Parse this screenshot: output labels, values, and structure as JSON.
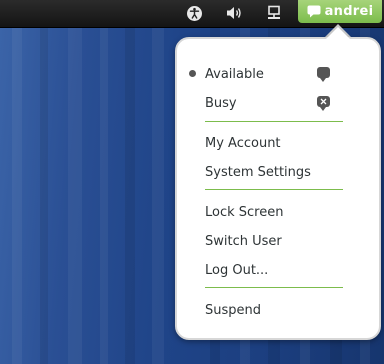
{
  "panel": {
    "icons": [
      "accessibility-icon",
      "volume-icon",
      "network-icon"
    ],
    "user_name": "andrei",
    "accent": "#7cbc4c"
  },
  "menu": {
    "status": {
      "available": "Available",
      "busy": "Busy"
    },
    "account": {
      "my_account": "My Account",
      "system_settings": "System Settings"
    },
    "session": {
      "lock_screen": "Lock Screen",
      "switch_user": "Switch User",
      "log_out": "Log Out..."
    },
    "power": {
      "suspend": "Suspend"
    }
  }
}
